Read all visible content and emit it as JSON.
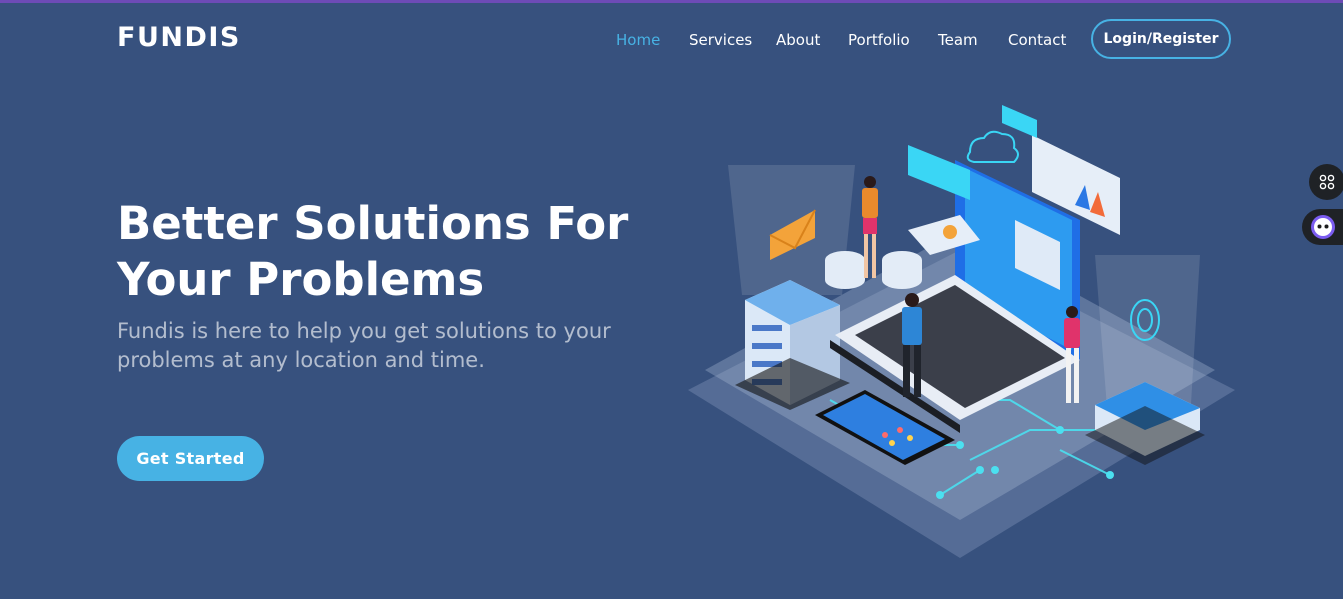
{
  "brand": {
    "logo_text": "FUNDIS"
  },
  "nav": {
    "items": [
      {
        "label": "Home",
        "active": true
      },
      {
        "label": "Services"
      },
      {
        "label": "About"
      },
      {
        "label": "Portfolio"
      },
      {
        "label": "Team"
      },
      {
        "label": "Contact"
      }
    ],
    "login_label": "Login/Register"
  },
  "hero": {
    "title_line1": "Better Solutions For",
    "title_line2": "Your Problems",
    "subtitle": "Fundis is here to help you get solutions to your problems at any location and time.",
    "cta_label": "Get Started"
  },
  "colors": {
    "background": "#37517e",
    "accent": "#47b2e4",
    "text": "#ffffff"
  },
  "side_widgets": [
    {
      "icon": "grid-icon"
    },
    {
      "icon": "assistant-bot-icon"
    }
  ]
}
